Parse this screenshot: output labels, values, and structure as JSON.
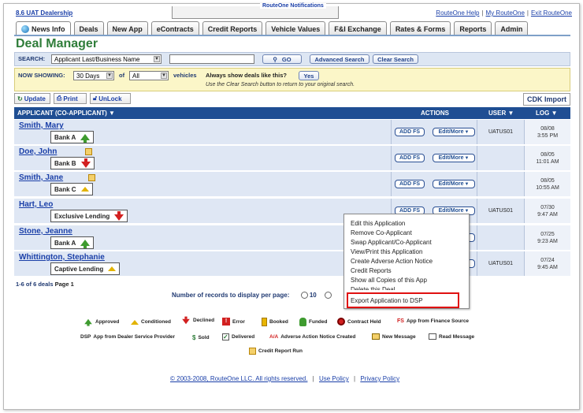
{
  "header": {
    "dealership": "8.6 UAT Dealership",
    "notifications_label": "RouteOne Notifications",
    "links": [
      "RouteOne Help",
      "My RouteOne",
      "Exit RouteOne"
    ]
  },
  "tabs": [
    "News Info",
    "Deals",
    "New App",
    "eContracts",
    "Credit Reports",
    "Vehicle Values",
    "F&I Exchange",
    "Rates & Forms",
    "Reports",
    "Admin"
  ],
  "page_title": "Deal Manager",
  "search": {
    "label": "SEARCH:",
    "field_select": "Applicant Last/Business Name",
    "input_value": "",
    "go_label": "GO",
    "advanced_label": "Advanced Search",
    "clear_label": "Clear Search"
  },
  "showing": {
    "label": "NOW SHOWING:",
    "period": "30 Days",
    "of_label": "of",
    "vehicle_filter": "All",
    "vehicles_label": "vehicles",
    "always_show": "Always show deals like this?",
    "yes_label": "Yes",
    "hint": "Use the Clear Search button to return to your original search."
  },
  "toolbar": {
    "update": "Update",
    "print": "Print",
    "unlock": "UnLock",
    "cdk": "CDK Import"
  },
  "table": {
    "col_applicant": "APPLICANT (CO-APPLICANT)",
    "col_actions": "ACTIONS",
    "col_user": "USER",
    "col_log": "LOG",
    "add_fs": "ADD FS",
    "edit_more": "Edit/More",
    "rows": [
      {
        "name": "Smith, Mary",
        "lender": "Bank A",
        "status": "approved",
        "user": "UATUS01",
        "log_date": "08/08",
        "log_time": "3:55 PM"
      },
      {
        "name": "Doe, John",
        "lender": "Bank B",
        "status": "declined",
        "user": "",
        "log_date": "08/05",
        "log_time": "11:01 AM"
      },
      {
        "name": "Smith, Jane",
        "lender": "Bank C",
        "status": "conditioned",
        "user": "",
        "log_date": "08/05",
        "log_time": "10:55 AM"
      },
      {
        "name": "Hart, Leo",
        "lender": "Exclusive Lending",
        "status": "declined",
        "user": "UATUS01",
        "log_date": "07/30",
        "log_time": "9:47 AM"
      },
      {
        "name": "Stone, Jeanne",
        "lender": "Bank A",
        "status": "approved",
        "user": "",
        "log_date": "07/25",
        "log_time": "9:23 AM"
      },
      {
        "name": "Whittington, Stephanie",
        "lender": "Captive Lending",
        "status": "conditioned",
        "user": "UATUS01",
        "log_date": "07/24",
        "log_time": "9:45 AM"
      }
    ]
  },
  "context_menu": {
    "items": [
      "Edit this Application",
      "Remove Co-Applicant",
      "Swap Applicant/Co-Applicant",
      "View/Print this Application",
      "Create Adverse Action Notice",
      "Credit Reports",
      "Show all Copies of this App",
      "Delete this Deal",
      "Export Application to DSP"
    ]
  },
  "pager": {
    "deals_info": "1-6 of 6 deals",
    "page_info": "Page 1",
    "per_page_label": "Number of records to display per page:",
    "option_10": "10"
  },
  "legend": {
    "approved": "Approved",
    "conditioned": "Conditioned",
    "declined": "Declined",
    "error": "Error",
    "booked": "Booked",
    "funded": "Funded",
    "contract_held": "Contract Held",
    "fs_code": "FS",
    "fs_label": "App from Finance Source",
    "dsp_code": "DSP",
    "dsp_label": "App from Dealer Service Provider",
    "sold_code": "$",
    "sold": "Sold",
    "delivered": "Delivered",
    "aa_code": "A/A",
    "aa_label": "Adverse Action Notice Created",
    "new_message": "New Message",
    "read_message": "Read Message",
    "credit_report_run": "Credit Report Run"
  },
  "footer": {
    "copyright": "© 2003-2008, RouteOne LLC. All rights reserved.",
    "use_policy": "Use Policy",
    "privacy_policy": "Privacy Policy"
  },
  "colors": {
    "title_green": "#2f7d3a",
    "header_blue": "#1f4e93",
    "row_blue": "#dfe7f4",
    "highlight_red": "#e01010"
  }
}
